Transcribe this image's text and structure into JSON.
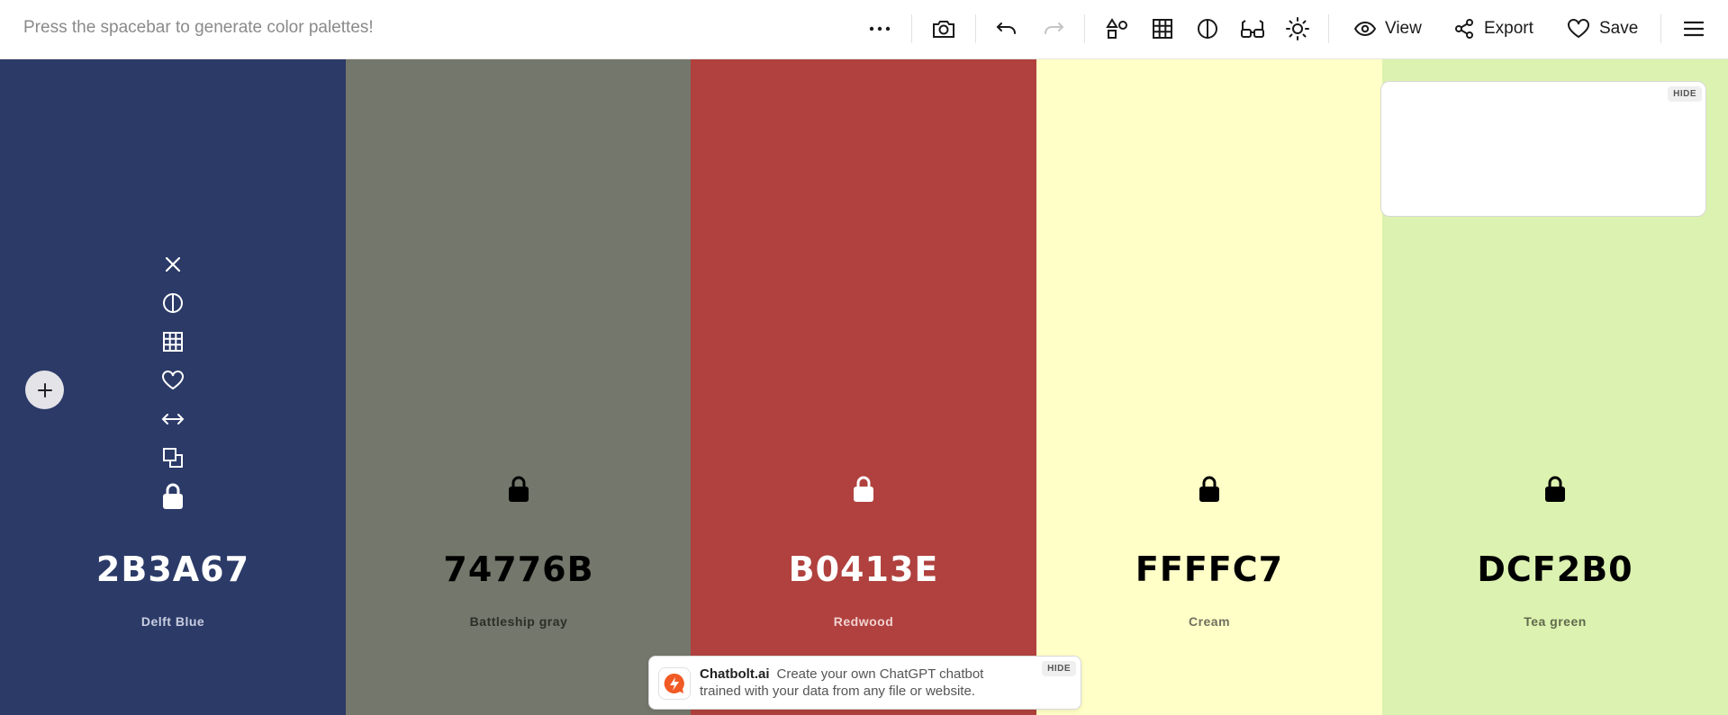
{
  "toolbar": {
    "hint": "Press the spacebar to generate color palettes!",
    "view_label": "View",
    "export_label": "Export",
    "save_label": "Save"
  },
  "colors": [
    {
      "hex": "2B3A67",
      "name": "Delft Blue",
      "bg": "#2B3A67",
      "fg": "#ffffff",
      "sub": "#c9cfe0"
    },
    {
      "hex": "74776B",
      "name": "Battleship gray",
      "bg": "#74776B",
      "fg": "#000000",
      "sub": "#2d2e28"
    },
    {
      "hex": "B0413E",
      "name": "Redwood",
      "bg": "#B0413E",
      "fg": "#ffffff",
      "sub": "#f0d2d1"
    },
    {
      "hex": "FFFFC7",
      "name": "Cream",
      "bg": "#FFFFC7",
      "fg": "#000000",
      "sub": "#707060"
    },
    {
      "hex": "DCF2B0",
      "name": "Tea green",
      "bg": "#DCF2B0",
      "fg": "#000000",
      "sub": "#606a4c"
    }
  ],
  "adbox": {
    "hide_label": "HIDE"
  },
  "banner": {
    "title": "Chatbolt.ai",
    "text": "Create your own ChatGPT chatbot trained with your data from any file or website.",
    "hide_label": "HIDE"
  }
}
